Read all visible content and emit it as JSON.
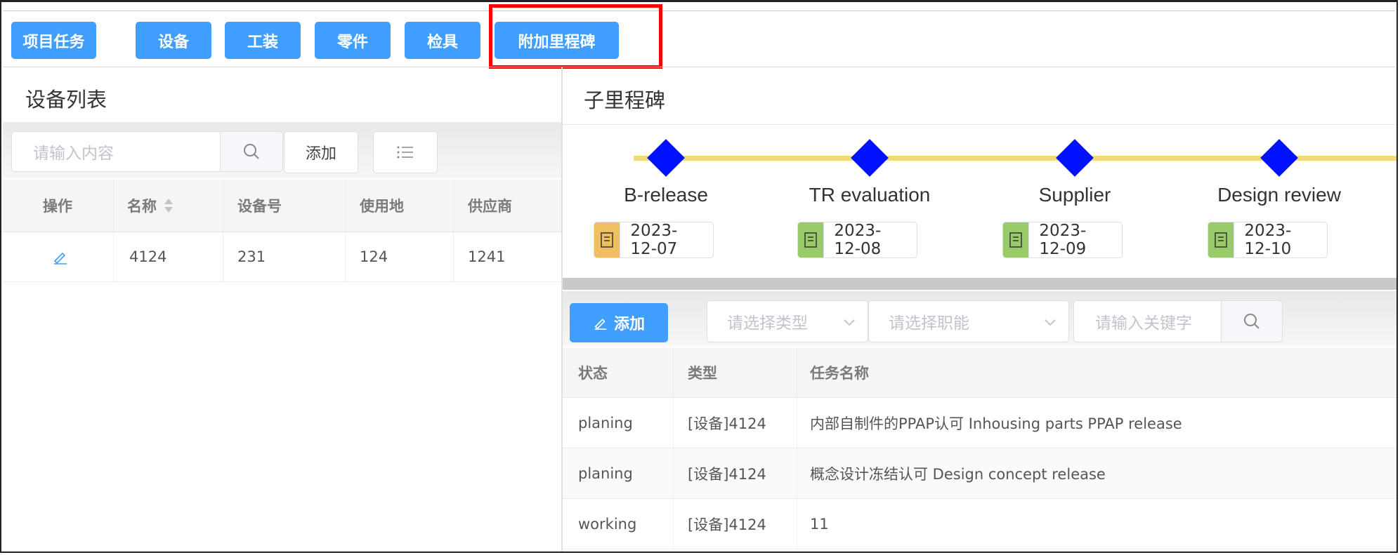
{
  "top_tabs": [
    {
      "label": "项目任务"
    },
    {
      "label": "设备"
    },
    {
      "label": "工装"
    },
    {
      "label": "零件"
    },
    {
      "label": "检具"
    },
    {
      "label": "附加里程碑"
    }
  ],
  "highlight_color": "#ff0000",
  "accent_color": "#409eff",
  "left_panel": {
    "title": "设备列表",
    "search_placeholder": "请输入内容",
    "add_label": "添加",
    "list_icon": "list-icon",
    "columns": [
      "操作",
      "名称",
      "设备号",
      "使用地",
      "供应商"
    ],
    "rows": [
      {
        "action_icon": "edit-icon",
        "name": "4124",
        "number": "231",
        "location": "124",
        "supplier": "1241"
      }
    ]
  },
  "right_panel": {
    "title": "子里程碑",
    "milestones": [
      {
        "label": "B-release",
        "date": "2023-12-07",
        "status_color": "#f0c060"
      },
      {
        "label": "TR evaluation",
        "date": "2023-12-08",
        "status_color": "#9acb6a"
      },
      {
        "label": "Supplier",
        "date": "2023-12-09",
        "status_color": "#9acb6a"
      },
      {
        "label": "Design review",
        "date": "2023-12-10",
        "status_color": "#9acb6a"
      }
    ],
    "add_label": "添加",
    "type_placeholder": "请选择类型",
    "function_placeholder": "请选择职能",
    "keyword_placeholder": "请输入关键字",
    "columns": [
      "状态",
      "类型",
      "任务名称"
    ],
    "rows": [
      {
        "status": "planing",
        "type": "[设备]4124",
        "name": "内部自制件的PPAP认可 Inhousing parts PPAP release"
      },
      {
        "status": "planing",
        "type": "[设备]4124",
        "name": "概念设计冻结认可 Design concept release"
      },
      {
        "status": "working",
        "type": "[设备]4124",
        "name": "11"
      }
    ]
  }
}
